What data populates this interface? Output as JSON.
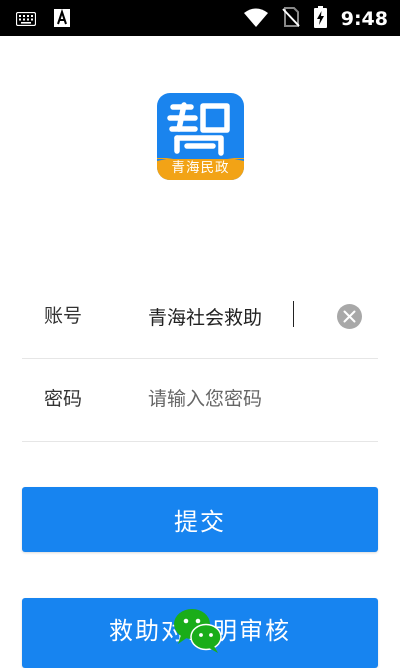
{
  "status_bar": {
    "time": "9:48",
    "icons": [
      "keyboard-icon",
      "font-a-icon",
      "wifi-icon",
      "no-sim-icon",
      "battery-charging-icon"
    ]
  },
  "logo": {
    "caption": "青海民政",
    "colors": {
      "primary": "#1a84ee",
      "caption_bg": "#f2a316"
    }
  },
  "login_form": {
    "account": {
      "label": "账号",
      "value": "青海社会救助"
    },
    "password": {
      "label": "密码",
      "placeholder": "请输入您密码"
    }
  },
  "buttons": {
    "submit_label": "提交",
    "rescue_label": "救助对象明审核"
  },
  "colors": {
    "accent": "#1784f0",
    "divider": "#e6e6e6",
    "wechat": "#1aad19"
  }
}
